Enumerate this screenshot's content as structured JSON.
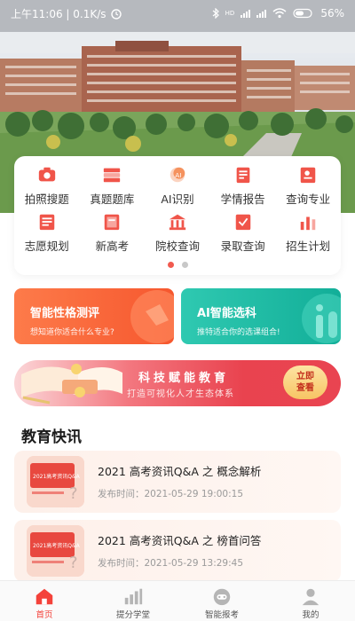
{
  "status_bar": {
    "time_speed": "上午11:06 | 0.1K/s",
    "network": "HD",
    "battery": "56%"
  },
  "menu": {
    "items": [
      {
        "label": "拍照搜题",
        "icon": "camera-icon",
        "color": "#f0554a"
      },
      {
        "label": "真题题库",
        "icon": "books-icon",
        "color": "#f0554a"
      },
      {
        "label": "AI识别",
        "icon": "ai-icon",
        "color": "#f5925e"
      },
      {
        "label": "学情报告",
        "icon": "report-icon",
        "color": "#f0554a"
      },
      {
        "label": "查询专业",
        "icon": "search-major-icon",
        "color": "#f0554a"
      },
      {
        "label": "志愿规划",
        "icon": "plan-icon",
        "color": "#f0554a"
      },
      {
        "label": "新高考",
        "icon": "book-icon",
        "color": "#f0554a"
      },
      {
        "label": "院校查询",
        "icon": "school-icon",
        "color": "#f0554a"
      },
      {
        "label": "录取查询",
        "icon": "admission-icon",
        "color": "#f0554a"
      },
      {
        "label": "招生计划",
        "icon": "enroll-chart-icon",
        "color": "#f0554a"
      }
    ],
    "page_count": 2,
    "active_page": 1
  },
  "promos": {
    "personality": {
      "title": "智能性格测评",
      "subtitle": "想知道你适合什么专业?"
    },
    "subject": {
      "title": "AI智能选科",
      "subtitle": "推特适合你的选课组合!"
    }
  },
  "banner": {
    "title": "科技赋能教育",
    "subtitle": "打造可视化人才生态体系",
    "button": "立即查看"
  },
  "news": {
    "section_title": "教育快讯",
    "items": [
      {
        "title": "2021 高考资讯Q&A 之 概念解析",
        "time": "发布时间：2021-05-29 19:00:15",
        "thumb_text": "2021高考资讯Q&A"
      },
      {
        "title": "2021 高考资讯Q&A 之 榜首问答",
        "time": "发布时间：2021-05-29 13:29:45",
        "thumb_text": "2021高考资讯Q&A"
      }
    ]
  },
  "bottom_nav": {
    "items": [
      {
        "label": "首页",
        "icon": "home-icon",
        "active": true
      },
      {
        "label": "提分学堂",
        "icon": "bar-chart-icon",
        "active": false
      },
      {
        "label": "智能报考",
        "icon": "robot-icon",
        "active": false
      },
      {
        "label": "我的",
        "icon": "user-icon",
        "active": false
      }
    ]
  },
  "colors": {
    "accent": "#f4423a",
    "orange": "#f6572e",
    "teal": "#12ae98"
  }
}
